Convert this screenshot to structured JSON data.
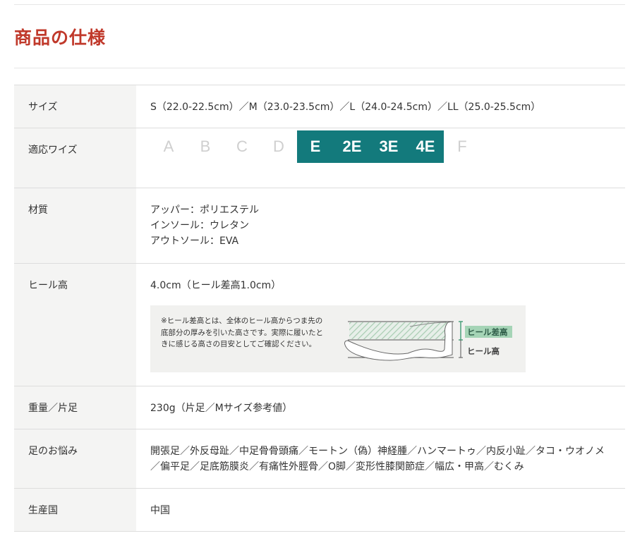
{
  "section_title": "商品の仕様",
  "colors": {
    "title": "#c0392b",
    "width_active": "#137a7c",
    "header_bg": "#f4f4f3"
  },
  "rows": {
    "size": {
      "label": "サイズ",
      "value": "S（22.0-22.5cm）／M（23.0-23.5cm）／L（24.0-24.5cm）／LL（25.0-25.5cm）"
    },
    "width": {
      "label": "適応ワイズ",
      "options": [
        {
          "text": "A",
          "active": false
        },
        {
          "text": "B",
          "active": false
        },
        {
          "text": "C",
          "active": false
        },
        {
          "text": "D",
          "active": false
        },
        {
          "text": "E",
          "active": true
        },
        {
          "text": "2E",
          "active": true
        },
        {
          "text": "3E",
          "active": true
        },
        {
          "text": "4E",
          "active": true
        },
        {
          "text": "F",
          "active": false
        }
      ]
    },
    "material": {
      "label": "材質",
      "lines": [
        "アッパー：ポリエステル",
        "インソール：ウレタン",
        "アウトソール：EVA"
      ]
    },
    "heel": {
      "label": "ヒール高",
      "value": "4.0cm（ヒール差高1.0cm）",
      "note": "※ヒール差高とは、全体のヒール高からつま先の底部分の厚みを引いた高さです。実際に履いたときに感じる高さの目安としてご確認ください。",
      "diagram_label_diff": "ヒール差高",
      "diagram_label_height": "ヒール高"
    },
    "weight": {
      "label": "重量／片足",
      "value": "230g（片足／Mサイズ参考値）"
    },
    "concerns": {
      "label": "足のお悩み",
      "value": "開張足／外反母趾／中足骨骨頭痛／モートン（偽）神経腫／ハンマートゥ／内反小趾／タコ・ウオノメ／偏平足／足底筋膜炎／有痛性外脛骨／O脚／変形性膝関節症／幅広・甲高／むくみ"
    },
    "origin": {
      "label": "生産国",
      "value": "中国"
    }
  }
}
